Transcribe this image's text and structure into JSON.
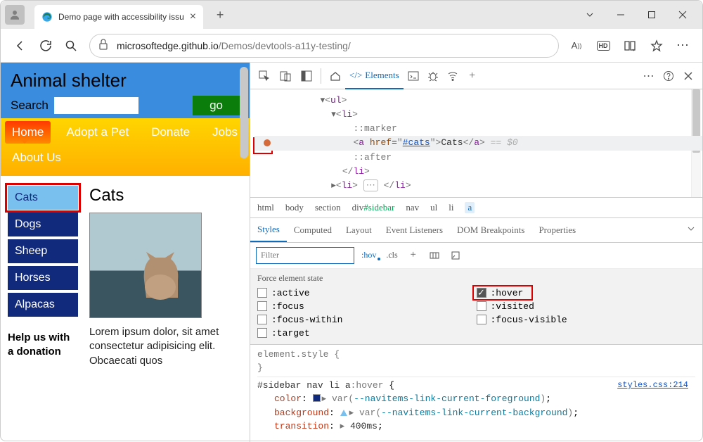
{
  "browser": {
    "tab_title": "Demo page with accessibility issu",
    "url_host": "microsoftedge.github.io",
    "url_path": "/Demos/devtools-a11y-testing/"
  },
  "page": {
    "title": "Animal shelter",
    "search_label": "Search",
    "go_label": "go",
    "nav": [
      "Home",
      "Adopt a Pet",
      "Donate",
      "Jobs",
      "About Us"
    ],
    "sidebar": [
      "Cats",
      "Dogs",
      "Sheep",
      "Horses",
      "Alpacas"
    ],
    "heading": "Cats",
    "lorem": "Lorem ipsum dolor, sit amet consectetur adipisicing elit. Obcaecati quos",
    "help": "Help us with a donation"
  },
  "devtools": {
    "elements_tab": "Elements",
    "dom": {
      "ul": "ul",
      "li": "li",
      "marker": "::marker",
      "after": "::after",
      "a_tag": "a",
      "href_attr": "href",
      "href_val": "#cats",
      "a_text": "Cats",
      "eq0": " == $0",
      "ellipsis": "⋯"
    },
    "crumbs": {
      "html": "html",
      "body": "body",
      "section": "section",
      "div": "div",
      "sidebar_id": "#sidebar",
      "nav": "nav",
      "ul": "ul",
      "li": "li",
      "a": "a"
    },
    "styles_tabs": {
      "styles": "Styles",
      "computed": "Computed",
      "layout": "Layout",
      "listeners": "Event Listeners",
      "dom_bp": "DOM Breakpoints",
      "properties": "Properties"
    },
    "filter_placeholder": "Filter",
    "hov": ":hov",
    "cls": ".cls",
    "force_title": "Force element state",
    "states": {
      "active": ":active",
      "hover": ":hover",
      "focus": ":focus",
      "visited": ":visited",
      "focus_within": ":focus-within",
      "focus_visible": ":focus-visible",
      "target": ":target"
    },
    "rules": {
      "element_style": "element.style {",
      "brace_close": "}",
      "selector_plain": "#sidebar nav li a",
      "selector_pseudo": ":hover",
      "src": "styles.css:214",
      "p1_name": "color",
      "p1_swatch": "#112a7c",
      "p1_var": "--navitems-link-current-foreground",
      "p2_name": "background",
      "p2_var": "--navitems-link-current-background",
      "p3_name": "transition",
      "p3_val": "400ms"
    }
  }
}
